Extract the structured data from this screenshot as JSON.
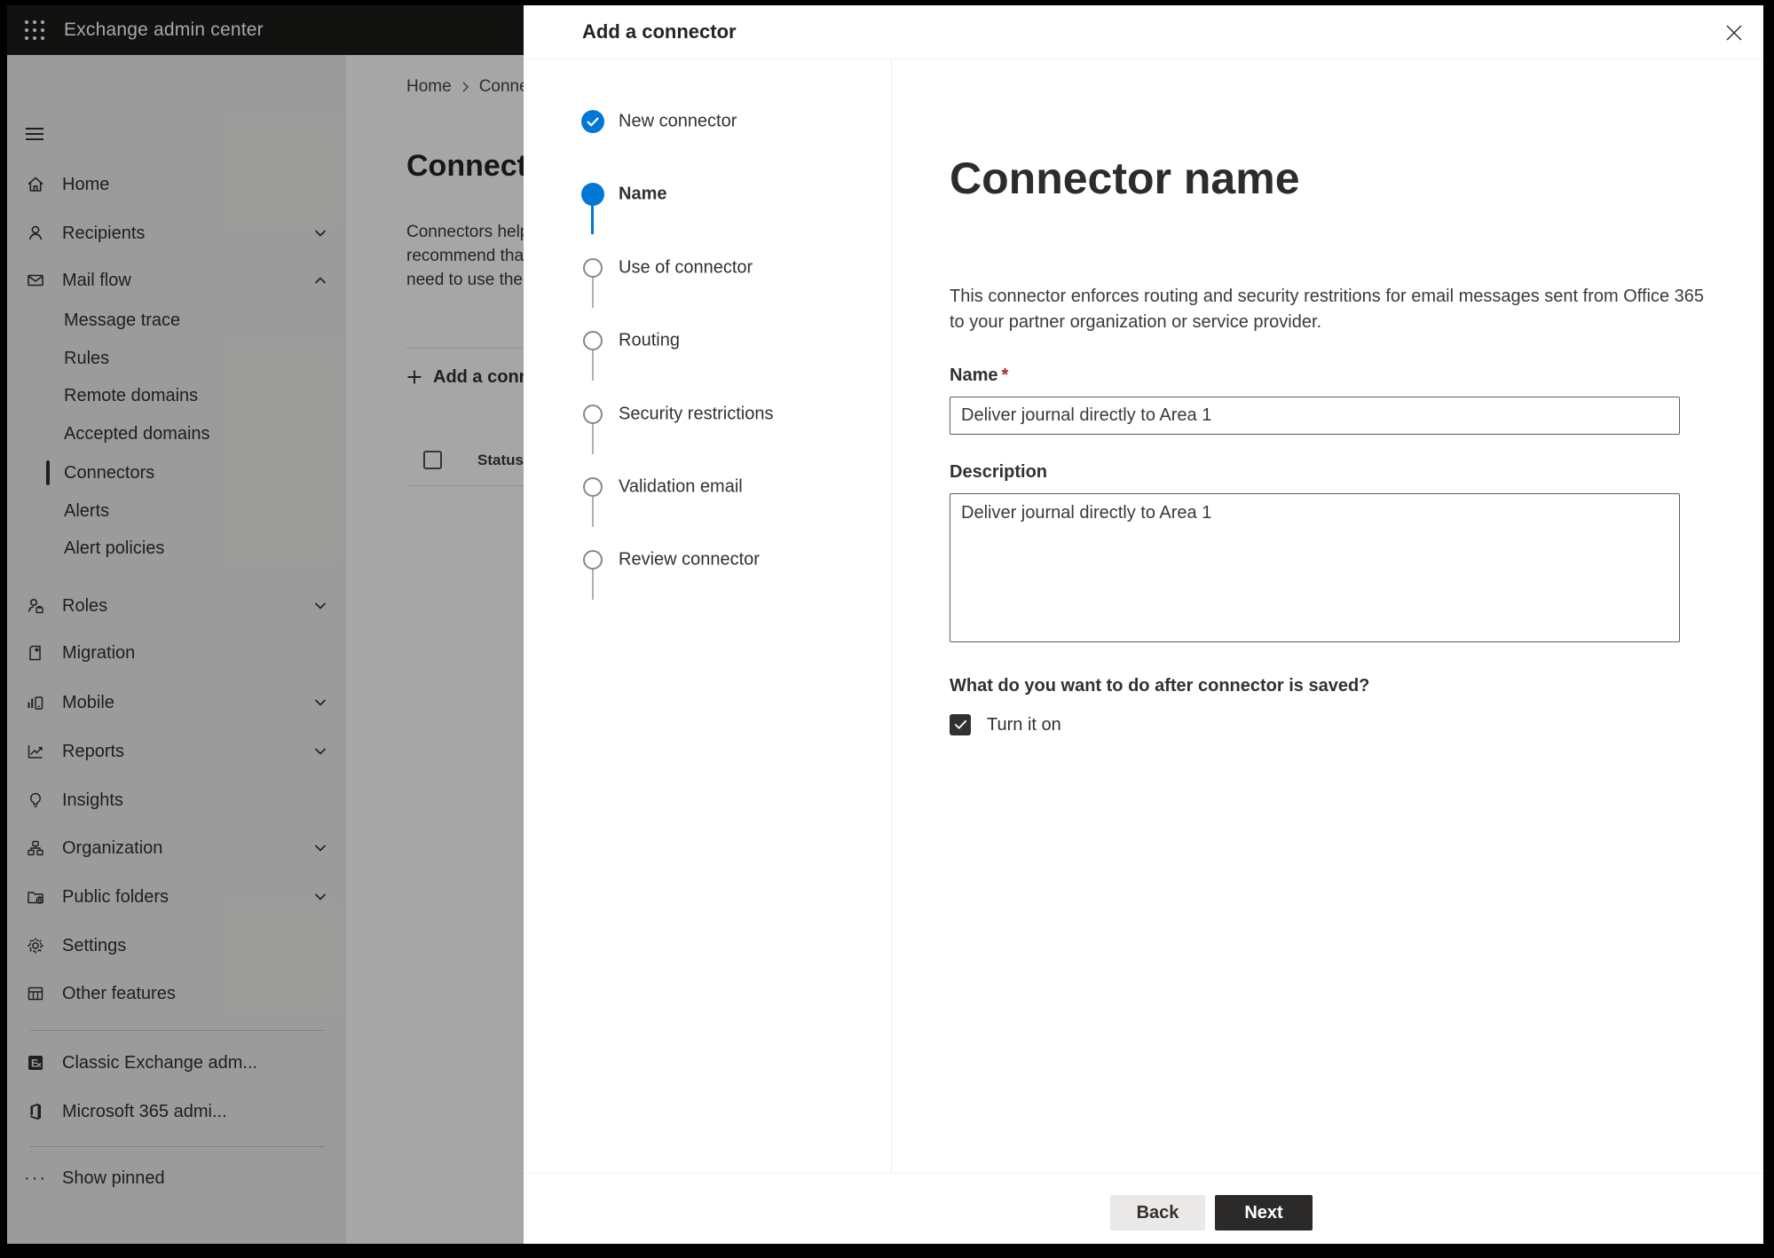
{
  "topbar": {
    "app_title": "Exchange admin center"
  },
  "sidebar": {
    "items": [
      {
        "label": "Home"
      },
      {
        "label": "Recipients",
        "chevron": "down"
      },
      {
        "label": "Mail flow",
        "chevron": "up",
        "expanded": true
      },
      {
        "label": "Message trace",
        "indent": true
      },
      {
        "label": "Rules",
        "indent": true
      },
      {
        "label": "Remote domains",
        "indent": true
      },
      {
        "label": "Accepted domains",
        "indent": true
      },
      {
        "label": "Connectors",
        "indent": true,
        "selected": true
      },
      {
        "label": "Alerts",
        "indent": true
      },
      {
        "label": "Alert policies",
        "indent": true
      },
      {
        "label": "Roles",
        "chevron": "down"
      },
      {
        "label": "Migration"
      },
      {
        "label": "Mobile",
        "chevron": "down"
      },
      {
        "label": "Reports",
        "chevron": "down"
      },
      {
        "label": "Insights"
      },
      {
        "label": "Organization",
        "chevron": "down"
      },
      {
        "label": "Public folders",
        "chevron": "down"
      },
      {
        "label": "Settings"
      },
      {
        "label": "Other features"
      }
    ],
    "footer_items": [
      {
        "label": "Classic Exchange adm..."
      },
      {
        "label": "Microsoft 365 admi..."
      },
      {
        "label": "Show pinned",
        "icon_glyph": "···"
      }
    ]
  },
  "page": {
    "breadcrumb": {
      "home": "Home",
      "current": "Connectors"
    },
    "title": "Connectors",
    "intro_lines": [
      "Connectors help",
      "recommend that",
      "need to use ther"
    ],
    "add_button": "Add a connector",
    "list_header": {
      "status": "Status"
    }
  },
  "dialog": {
    "title": "Add a connector",
    "steps": [
      {
        "label": "New connector",
        "state": "completed"
      },
      {
        "label": "Name",
        "state": "current"
      },
      {
        "label": "Use of connector",
        "state": "upcoming"
      },
      {
        "label": "Routing",
        "state": "upcoming"
      },
      {
        "label": "Security restrictions",
        "state": "upcoming"
      },
      {
        "label": "Validation email",
        "state": "upcoming"
      },
      {
        "label": "Review connector",
        "state": "upcoming"
      }
    ],
    "content": {
      "heading": "Connector name",
      "description_line1": "This connector enforces routing and security restritions for email messages sent from Office 365",
      "description_line2": "to your partner organization or service provider.",
      "name_label": "Name",
      "required_marker": "*",
      "name_value": "Deliver journal directly to Area 1",
      "description_label": "Description",
      "description_value": "Deliver journal directly to Area 1",
      "after_save_question": "What do you want to do after connector is saved?",
      "turn_on_label": "Turn it on",
      "turn_on_checked": true
    },
    "footer": {
      "back": "Back",
      "next": "Next"
    }
  },
  "colors": {
    "accent_blue": "#0078d4",
    "topbar_bg": "#1d1c1b",
    "sidebar_bg": "#f0efee",
    "text_primary": "#323130",
    "required_red": "#a4262c",
    "primary_button_bg": "#2b2a28",
    "secondary_button_bg": "#ebe9e7",
    "input_border": "#605e5c",
    "step_outline_gray": "#8a8886"
  }
}
